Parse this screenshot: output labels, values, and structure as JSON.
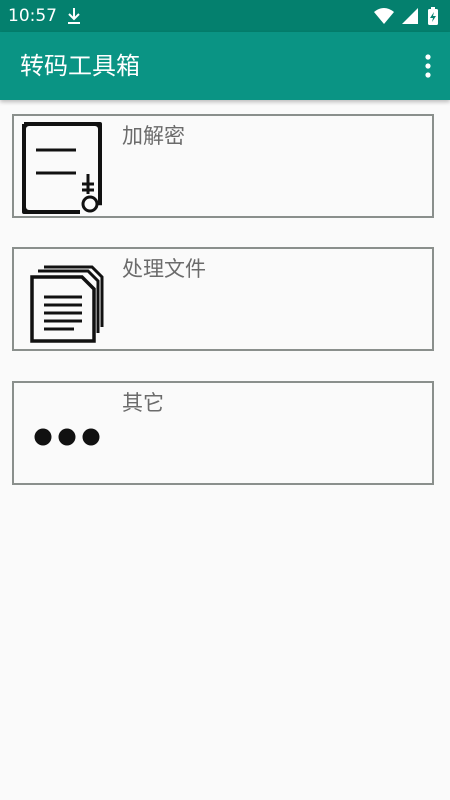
{
  "status_bar": {
    "time": "10:57",
    "icons": [
      "download-icon",
      "wifi-icon",
      "signal-icon",
      "battery-charging-icon"
    ]
  },
  "app_bar": {
    "title": "转码工具箱",
    "overflow_icon": "more-vert-icon"
  },
  "menu": {
    "items": [
      {
        "label": "加解密",
        "icon": "document-key-icon"
      },
      {
        "label": "处理文件",
        "icon": "files-icon"
      },
      {
        "label": "其它",
        "icon": "more-dots-icon"
      }
    ]
  },
  "colors": {
    "status_bar": "#04806e",
    "app_bar": "#0a9484",
    "background": "#fafafa",
    "card_border": "#8a8f8c",
    "label_text": "#6b6b6b"
  }
}
